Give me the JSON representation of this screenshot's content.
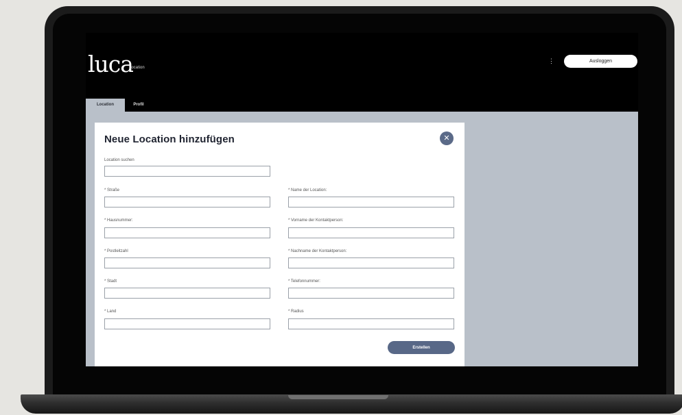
{
  "app": {
    "logo": "luca",
    "logo_subtitle": "Location",
    "menu_dots": "⋮",
    "logout_label": "Ausloggen"
  },
  "tabs": [
    {
      "label": "Location",
      "active": true
    },
    {
      "label": "Profil",
      "active": false
    }
  ],
  "modal": {
    "title": "Neue Location hinzufügen",
    "close_symbol": "✕",
    "search": {
      "label": "Location suchen",
      "value": ""
    },
    "left_fields": [
      {
        "label": "* Straße",
        "value": ""
      },
      {
        "label": "* Hausnummer:",
        "value": ""
      },
      {
        "label": "* Postleitzahl",
        "value": ""
      },
      {
        "label": "* Stadt",
        "value": ""
      },
      {
        "label": "* Land",
        "value": ""
      }
    ],
    "right_fields": [
      {
        "label": "* Name der Location:",
        "value": ""
      },
      {
        "label": "* Vorname der Kontaktperson:",
        "value": ""
      },
      {
        "label": "* Nachname der Kontaktperson:",
        "value": ""
      },
      {
        "label": "* Telefonnummer:",
        "value": ""
      },
      {
        "label": "* Radius",
        "value": ""
      }
    ],
    "submit_label": "Erstellen"
  },
  "colors": {
    "accent": "#586887",
    "close_button": "#5b6a88",
    "content_background": "#b9c0c9",
    "header_background": "#000000"
  },
  "icons": {
    "close": "close-icon",
    "menu": "more-vertical-icon"
  }
}
